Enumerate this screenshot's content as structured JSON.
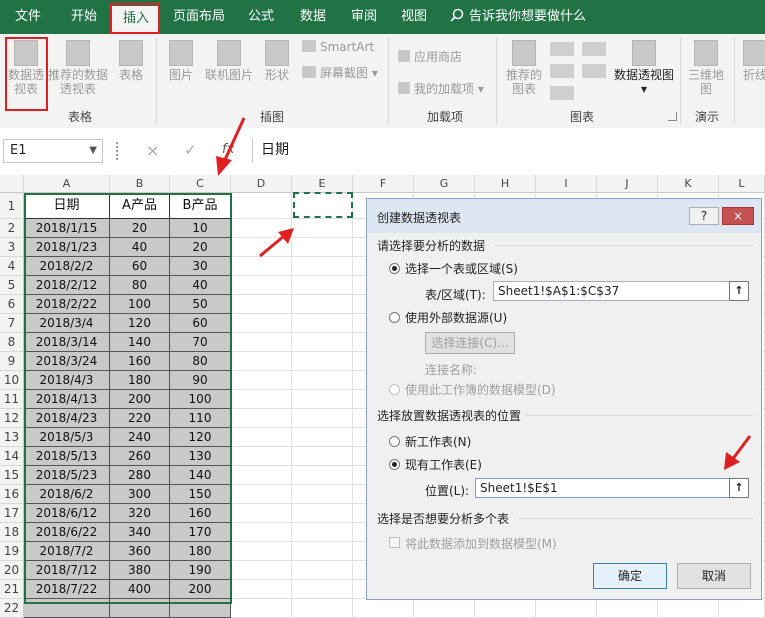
{
  "ribbon_tabs": [
    "文件",
    "开始",
    "插入",
    "页面布局",
    "公式",
    "数据",
    "审阅",
    "视图"
  ],
  "tell_me": "告诉我你想要做什么",
  "ribbon": {
    "pivot_table": "数据透视表",
    "recommended_pivot": "推荐的数据透视表",
    "table": "表格",
    "group_tables": "表格",
    "pictures": "图片",
    "online_pictures": "联机图片",
    "shapes": "形状",
    "smartart": "SmartArt",
    "screenshot": "屏幕截图",
    "group_illustrations": "插图",
    "app_store": "应用商店",
    "my_addins": "我的加载项",
    "group_addins": "加载项",
    "recommended_charts": "推荐的图表",
    "pivot_chart": "数据透视图",
    "group_charts": "图表",
    "map_3d": "三维地图",
    "group_tours": "演示",
    "sparkline": "折线"
  },
  "formula_bar": {
    "name_box": "E1",
    "cancel": "×",
    "enter": "✓",
    "fx": "fx",
    "value": "日期"
  },
  "columns": [
    "A",
    "B",
    "C",
    "D",
    "E",
    "F",
    "G",
    "H",
    "I",
    "J",
    "K",
    "L"
  ],
  "rows": [
    "1",
    "2",
    "3",
    "4",
    "5",
    "6",
    "7",
    "8",
    "9",
    "10",
    "11",
    "12",
    "13",
    "14",
    "15",
    "16",
    "17",
    "18",
    "19",
    "20",
    "21",
    "22"
  ],
  "table": {
    "headers": [
      "日期",
      "A产品",
      "B产品"
    ],
    "rows": [
      [
        "2018/1/15",
        "20",
        "10"
      ],
      [
        "2018/1/23",
        "40",
        "20"
      ],
      [
        "2018/2/2",
        "60",
        "30"
      ],
      [
        "2018/2/12",
        "80",
        "40"
      ],
      [
        "2018/2/22",
        "100",
        "50"
      ],
      [
        "2018/3/4",
        "120",
        "60"
      ],
      [
        "2018/3/14",
        "140",
        "70"
      ],
      [
        "2018/3/24",
        "160",
        "80"
      ],
      [
        "2018/4/3",
        "180",
        "90"
      ],
      [
        "2018/4/13",
        "200",
        "100"
      ],
      [
        "2018/4/23",
        "220",
        "110"
      ],
      [
        "2018/5/3",
        "240",
        "120"
      ],
      [
        "2018/5/13",
        "260",
        "130"
      ],
      [
        "2018/5/23",
        "280",
        "140"
      ],
      [
        "2018/6/2",
        "300",
        "150"
      ],
      [
        "2018/6/12",
        "320",
        "160"
      ],
      [
        "2018/6/22",
        "340",
        "170"
      ],
      [
        "2018/7/2",
        "360",
        "180"
      ],
      [
        "2018/7/12",
        "380",
        "190"
      ],
      [
        "2018/7/22",
        "400",
        "200"
      ],
      [
        "",
        "",
        ""
      ]
    ]
  },
  "dialog": {
    "title": "创建数据透视表",
    "help": "?",
    "close": "×",
    "section_data": "请选择要分析的数据",
    "opt_table_range": "选择一个表或区域(S)",
    "range_label": "表/区域(T):",
    "range_value": "Sheet1!$A$1:$C$37",
    "opt_external": "使用外部数据源(U)",
    "choose_conn": "选择连接(C)...",
    "conn_name": "连接名称:",
    "opt_data_model": "使用此工作簿的数据模型(D)",
    "section_location": "选择放置数据透视表的位置",
    "opt_new_sheet": "新工作表(N)",
    "opt_existing_sheet": "现有工作表(E)",
    "location_label": "位置(L):",
    "location_value": "Sheet1!$E$1",
    "section_multi": "选择是否想要分析多个表",
    "add_to_model": "将此数据添加到数据模型(M)",
    "ok": "确定",
    "cancel": "取消",
    "ref_icon": "↑"
  },
  "colors": {
    "excel_green": "#217346",
    "highlight_red": "#e02020",
    "data_fill": "#c9c9c9"
  }
}
